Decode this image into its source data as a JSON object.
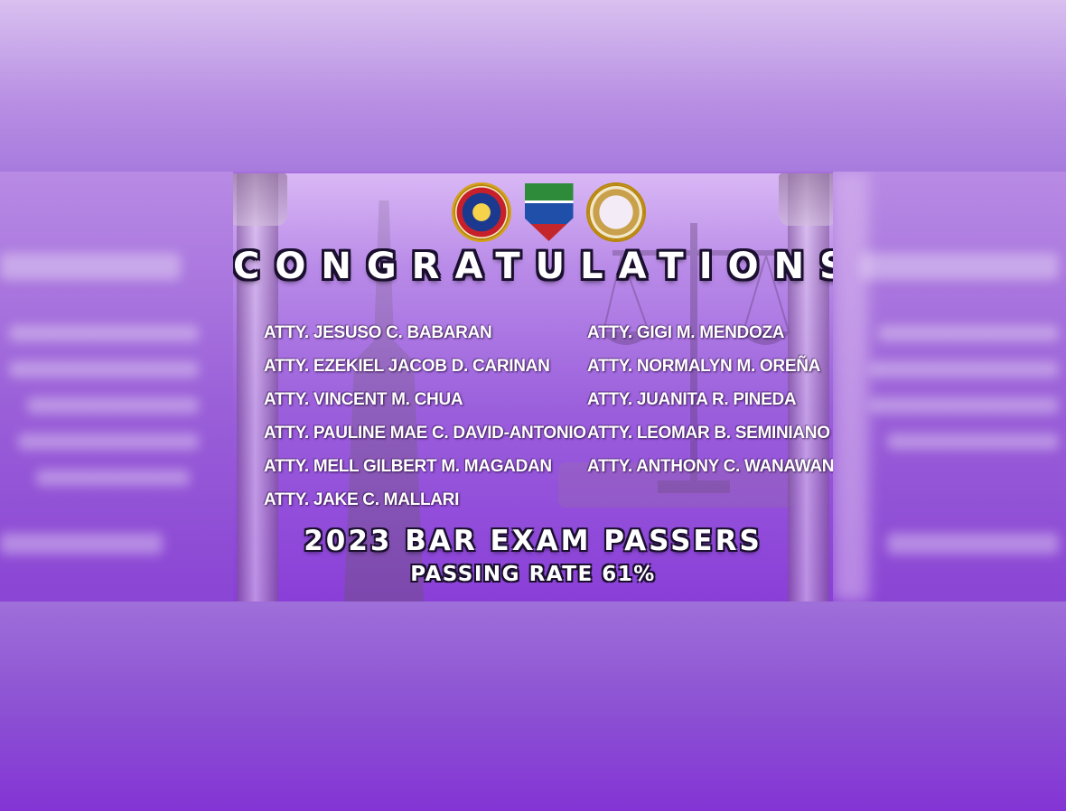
{
  "poster": {
    "heading": "CONGRATULATIONS!",
    "passers_left": [
      "ATTY. JESUSO C. BABARAN",
      "ATTY. EZEKIEL JACOB D. CARINAN",
      "ATTY. VINCENT M. CHUA",
      "ATTY. PAULINE MAE C. DAVID-ANTONIO",
      "ATTY. MELL GILBERT M. MAGADAN",
      "ATTY. JAKE C. MALLARI"
    ],
    "passers_right": [
      "ATTY. GIGI M. MENDOZA",
      "ATTY. NORMALYN M. OREÑA",
      "ATTY. JUANITA R. PINEDA",
      "ATTY. LEOMAR B. SEMINIANO",
      "ATTY. ANTHONY C. WANAWAN"
    ],
    "subtitle": "2023 BAR EXAM PASSERS",
    "passing_rate": "PASSING RATE 61%"
  },
  "logos": [
    "city-seal-icon",
    "university-shield-icon",
    "college-of-law-seal-icon"
  ],
  "colors": {
    "background_purple": "#9b5fdc",
    "deep_purple": "#8a3fd8",
    "text_white": "#ffffff",
    "outline_dark": "#1a0f2e"
  }
}
